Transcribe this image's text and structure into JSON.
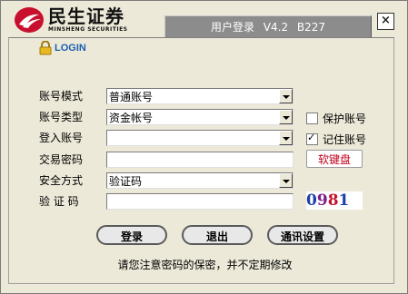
{
  "brand": {
    "name_cn": "民生证券",
    "name_en": "MINSHENG SECURITIES",
    "color": "#c8102e"
  },
  "window": {
    "title": "用户登录",
    "version": "V4.2",
    "build": "B227",
    "close_label": "×"
  },
  "login_header": "LOGIN",
  "form": {
    "account_mode": {
      "label": "账号模式",
      "value": "普通账号"
    },
    "account_type": {
      "label": "账号类型",
      "value": "资金帐号"
    },
    "login_account": {
      "label": "登入账号",
      "value": ""
    },
    "trade_password": {
      "label": "交易密码",
      "value": ""
    },
    "security_method": {
      "label": "安全方式",
      "value": "验证码"
    },
    "verify_code": {
      "label": "验 证 码",
      "value": ""
    }
  },
  "options": {
    "protect_account": {
      "label": "保护账号",
      "checked": false
    },
    "remember_account": {
      "label": "记住账号",
      "checked": true
    }
  },
  "soft_keyboard_label": "软键盘",
  "captcha": {
    "chars": [
      "0",
      "9",
      "8",
      "1"
    ],
    "colors": [
      "#1e3fa8",
      "#7a1f8c",
      "#c8102e",
      "#1e3fa8"
    ]
  },
  "buttons": {
    "login": "登录",
    "exit": "退出",
    "comm_settings": "通讯设置"
  },
  "notice": "请您注意密码的保密，并不定期修改"
}
